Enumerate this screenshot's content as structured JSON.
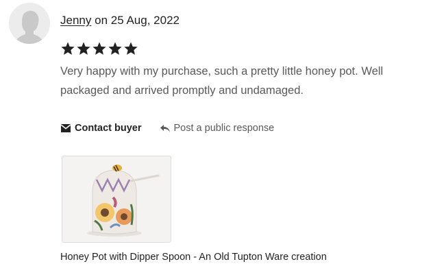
{
  "review": {
    "user_name": "Jenny",
    "date_prefix": "on",
    "date": "25 Aug, 2022",
    "rating": 5,
    "rating_max": 5,
    "text": "Very happy with my purchase, such a pretty little honey pot. Well packaged and arrived promptly and undamaged."
  },
  "actions": {
    "contact_label": "Contact buyer",
    "contact_icon": "envelope-icon",
    "respond_label": "Post a public response",
    "respond_icon": "reply-arrow-icon"
  },
  "product": {
    "title": "Honey Pot with Dipper Spoon - An Old Tupton Ware creation"
  },
  "colors": {
    "text_primary": "#222222",
    "text_secondary": "#595959",
    "star": "#222222",
    "avatar_bg": "#ececec",
    "avatar_silhouette": "#c9c9c9"
  }
}
